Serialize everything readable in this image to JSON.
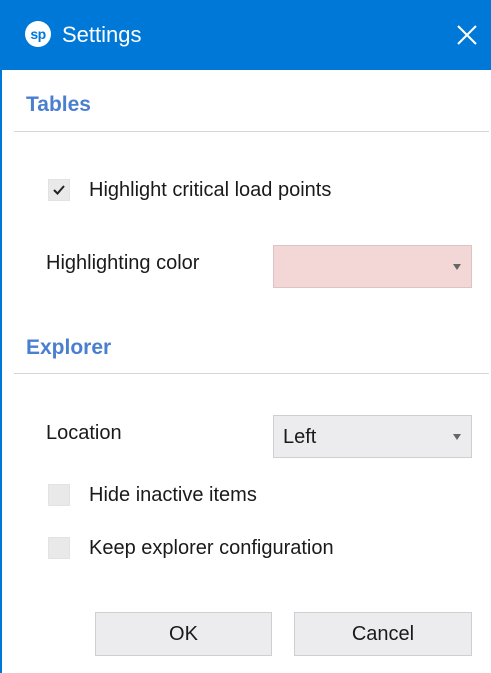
{
  "window": {
    "title": "Settings",
    "logo_text": "sp"
  },
  "tables": {
    "header": "Tables",
    "highlight_checkbox": {
      "label": "Highlight critical load points",
      "checked": true
    },
    "highlighting_color": {
      "label": "Highlighting color",
      "value": "",
      "swatch": "#f3d7d7"
    }
  },
  "explorer": {
    "header": "Explorer",
    "location": {
      "label": "Location",
      "value": "Left"
    },
    "hide_inactive": {
      "label": "Hide inactive items",
      "checked": false
    },
    "keep_config": {
      "label": "Keep explorer configuration",
      "checked": false
    }
  },
  "buttons": {
    "ok": "OK",
    "cancel": "Cancel"
  },
  "colors": {
    "titlebar": "#0078d7",
    "section_header": "#4a7fd0"
  },
  "icons": {
    "close": "close-icon",
    "check": "checkmark-icon",
    "dropdown": "chevron-down-icon"
  }
}
